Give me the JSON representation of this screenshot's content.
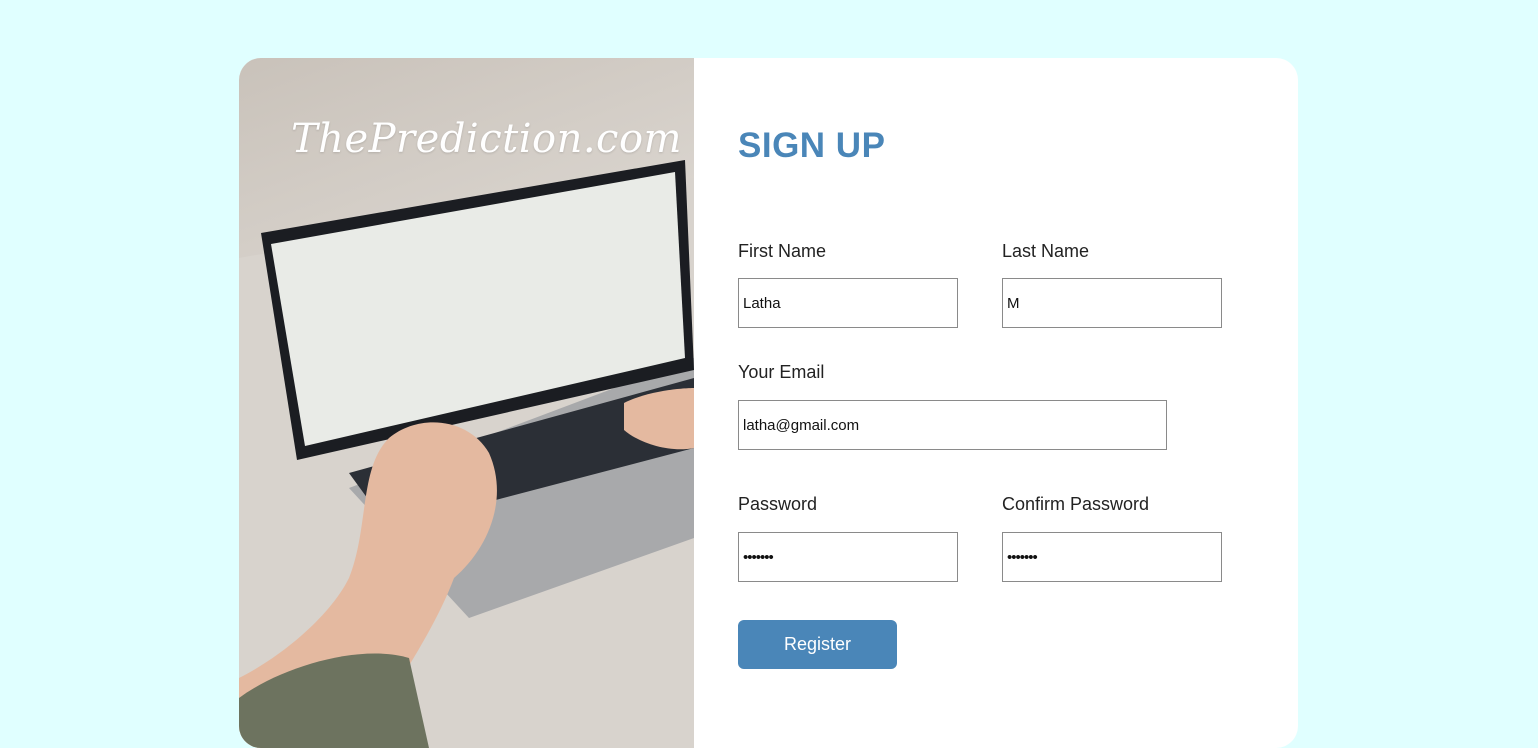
{
  "brand": {
    "logo_text": "ThePrediction.com"
  },
  "form": {
    "title": "SIGN UP",
    "first_name": {
      "label": "First Name",
      "value": "Latha"
    },
    "last_name": {
      "label": "Last Name",
      "value": "M"
    },
    "email": {
      "label": "Your Email",
      "value": "latha@gmail.com"
    },
    "password": {
      "label": "Password",
      "value": "1234567"
    },
    "confirm_password": {
      "label": "Confirm Password",
      "value": "1234567"
    },
    "register_label": "Register"
  },
  "colors": {
    "page_background": "#e0ffff",
    "accent": "#4a86b8",
    "card_background": "#ffffff"
  }
}
